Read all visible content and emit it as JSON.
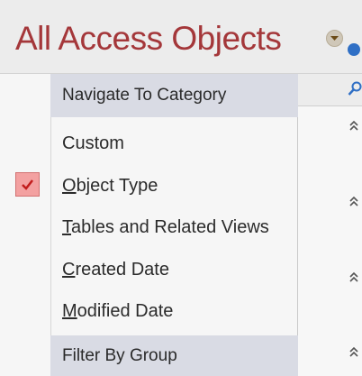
{
  "pane": {
    "title": "All Access Objects"
  },
  "menu": {
    "navigate_header": "Navigate To Category",
    "items": [
      {
        "first": "C",
        "rest": "ustom",
        "underline": false,
        "checked": false
      },
      {
        "first": "O",
        "rest": "bject Type",
        "underline": true,
        "checked": true
      },
      {
        "first": "T",
        "rest": "ables and Related Views",
        "underline": true,
        "checked": false
      },
      {
        "first": "C",
        "rest": "reated Date",
        "underline": true,
        "checked": false
      },
      {
        "first": "M",
        "rest": "odified Date",
        "underline": true,
        "checked": false
      }
    ],
    "filter_header": "Filter By Group"
  },
  "icons": {
    "dropdown": "chevron-down-icon",
    "search": "search-icon",
    "collapse": "double-chevron-up-icon",
    "check": "checkmark-icon"
  },
  "colors": {
    "title": "#a4373a",
    "menu_header_bg": "#d9dbe4",
    "check_bg": "#f3a1a1",
    "check_mark": "#c21d1d",
    "accent_dot": "#2f6fc5"
  }
}
